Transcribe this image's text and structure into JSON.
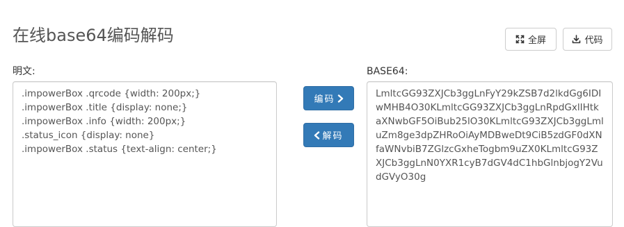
{
  "header": {
    "title": "在线base64编码解码",
    "fullscreen_label": "全屏",
    "code_label": "代码"
  },
  "plain": {
    "label": "明文:",
    "value": ".impowerBox .qrcode {width: 200px;}\n.impowerBox .title {display: none;}\n.impowerBox .info {width: 200px;}\n.status_icon {display: none}\n.impowerBox .status {text-align: center;}"
  },
  "base64": {
    "label": "BASE64:",
    "value": "LmltcGG93ZXJCb3ggLnFyY29kZSB7d2lkdGg6IDIwMHB4O30KLmltcGG93ZXJCb3ggLnRpdGxlIHtkaXNwbGF5OiBub25lO30KLmltcG93ZXJCb3ggLmluZm8ge3dpZHRoOiAyMDBweDt9CiB5zdGF0dXNfaWNvbiB7ZGlzcGxheTogbm9uZX0KLmltcG93ZXJCb3ggLnN0YXR1cyB7dGV4dC1hbGlnbjogY2VudGVyO30g"
  },
  "actions": {
    "encode_label": "编码",
    "decode_label": "解码"
  },
  "icons": {
    "fullscreen": "expand-arrows-icon",
    "code": "download-icon",
    "encode": "chevron-right-icon",
    "decode": "chevron-left-icon"
  },
  "colors": {
    "primary": "#337ab7",
    "border": "#cccccc"
  }
}
